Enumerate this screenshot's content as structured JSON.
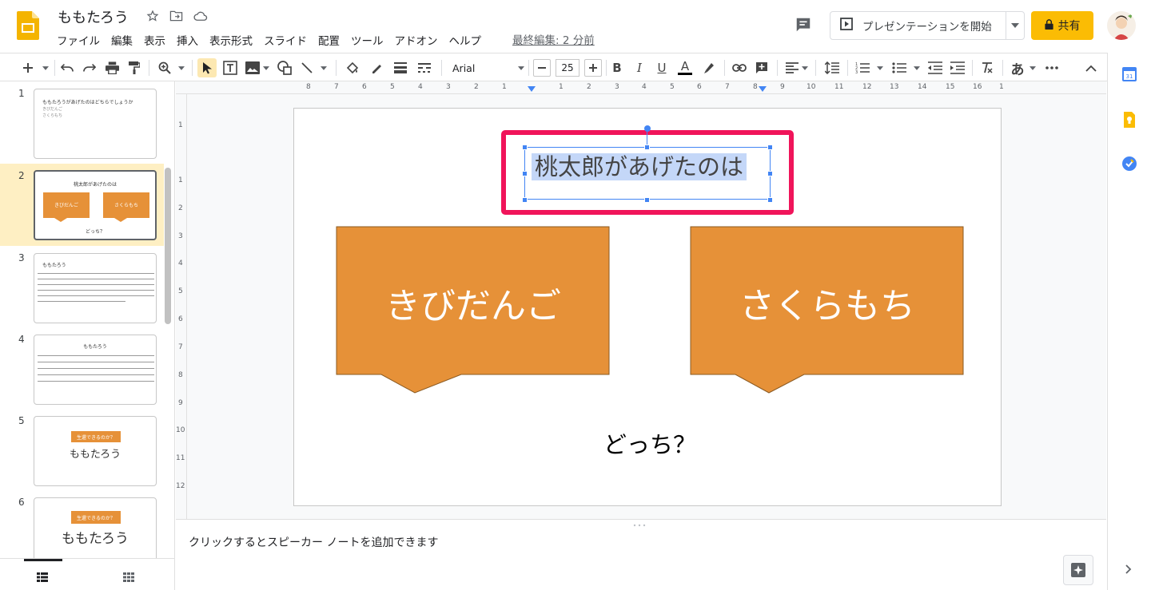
{
  "header": {
    "doc_title": "ももたろう",
    "menu": [
      "ファイル",
      "編集",
      "表示",
      "挿入",
      "表示形式",
      "スライド",
      "配置",
      "ツール",
      "アドオン",
      "ヘルプ"
    ],
    "last_edit": "最終編集: 2 分前",
    "present_label": "プレゼンテーションを開始",
    "share_label": "共有"
  },
  "toolbar": {
    "font_name": "Arial",
    "font_size": "25",
    "input_tools_label": "あ"
  },
  "ruler": {
    "h_labels": [
      "8",
      "7",
      "6",
      "5",
      "4",
      "3",
      "2",
      "1",
      "1",
      "2",
      "3",
      "4",
      "5",
      "6",
      "7",
      "8",
      "9",
      "10",
      "11",
      "12",
      "13",
      "14",
      "15",
      "16",
      "1"
    ],
    "v_labels": [
      "1",
      "1",
      "2",
      "3",
      "4",
      "5",
      "6",
      "7",
      "8",
      "9",
      "10",
      "11",
      "12"
    ]
  },
  "filmstrip": {
    "slides": [
      {
        "num": "1",
        "title": "ももたろうがあげたのはどちらでしょうか",
        "lines": [
          "きびだんご",
          "さくらもち"
        ]
      },
      {
        "num": "2",
        "title": "桃太郎があげたのは",
        "left": "きびだんご",
        "right": "さくらもち",
        "question": "どっち？"
      },
      {
        "num": "3",
        "title": "ももたろう"
      },
      {
        "num": "4",
        "title": "ももたろう"
      },
      {
        "num": "5",
        "banner": "生還できるのか？",
        "title": "ももたろう"
      },
      {
        "num": "6",
        "banner": "生還できるのか？",
        "title": "ももたろう"
      }
    ],
    "selected": "2"
  },
  "slide": {
    "title": "桃太郎があげたのは",
    "left_callout": "きびだんご",
    "right_callout": "さくらもち",
    "question": "どっち？",
    "callout_color": "#e69138",
    "highlight_color": "#f0145a"
  },
  "notes": {
    "placeholder": "クリックするとスピーカー ノートを追加できます"
  },
  "colors": {
    "accent": "#fbbc04",
    "selection": "#4285f4"
  }
}
